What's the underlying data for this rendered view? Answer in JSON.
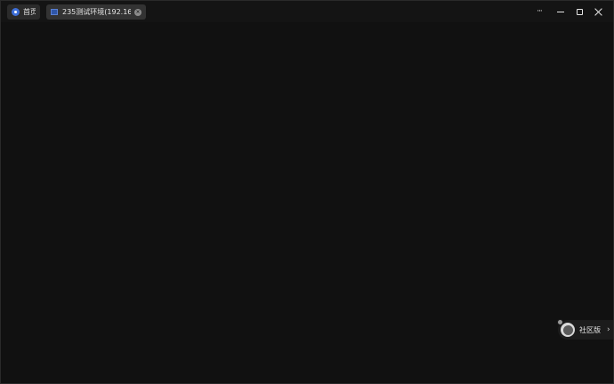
{
  "tabs": {
    "home": {
      "label": "首页",
      "icon": "home-eye-icon"
    },
    "session": {
      "label": "235测试环境(192.16...",
      "icon": "terminal-icon",
      "close": "×"
    }
  },
  "window_controls": {
    "more": "···"
  },
  "community": {
    "label": "社区版",
    "chevron": "›"
  },
  "colors": {
    "background": "#111111",
    "tab_bg": "#2b2b2b",
    "accent": "#3e6fd8"
  }
}
